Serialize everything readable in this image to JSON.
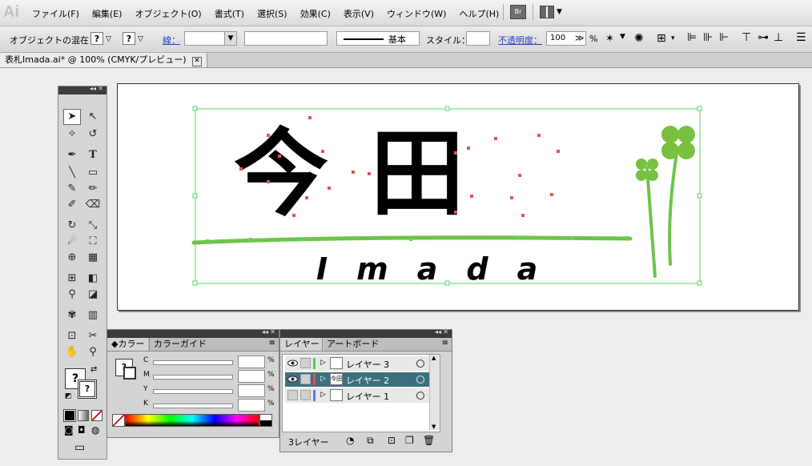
{
  "app_logo": "Ai",
  "menu": [
    "ファイル(F)",
    "編集(E)",
    "オブジェクト(O)",
    "書式(T)",
    "選択(S)",
    "効果(C)",
    "表示(V)",
    "ウィンドウ(W)",
    "ヘルプ(H)"
  ],
  "bridge_label": "Br",
  "control": {
    "selection_label": "オブジェクトの混在",
    "stroke_label": "線：",
    "stroke_style": "基本",
    "style_label": "スタイル：",
    "opacity_label": "不透明度：",
    "opacity_value": "100",
    "opacity_unit": "%"
  },
  "document_tab": "表札Imada.ai* @ 100% (CMYK/プレビュー)",
  "artwork": {
    "kanji": "今田",
    "roman": "Imada"
  },
  "color_panel": {
    "tabs": [
      "カラー",
      "カラーガイド"
    ],
    "channels": [
      "C",
      "M",
      "Y",
      "K"
    ],
    "unit": "%"
  },
  "layers_panel": {
    "tabs": [
      "レイヤー",
      "アートボード"
    ],
    "layers": [
      {
        "name": "レイヤー 3",
        "color": "#4fd14f",
        "selected": false
      },
      {
        "name": "レイヤー 2",
        "color": "#f05050",
        "selected": true
      },
      {
        "name": "レイヤー 1",
        "color": "#5a7cf0",
        "selected": false
      }
    ],
    "count_label": "3レイヤー"
  }
}
